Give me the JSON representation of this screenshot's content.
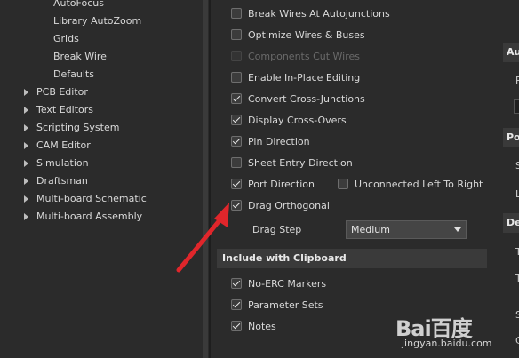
{
  "tree": {
    "subitems": [
      "AutoFocus",
      "Library AutoZoom",
      "Grids",
      "Break Wire",
      "Defaults"
    ],
    "categories": [
      "PCB Editor",
      "Text Editors",
      "Scripting System",
      "CAM Editor",
      "Simulation",
      "Draftsman",
      "Multi-board Schematic",
      "Multi-board Assembly"
    ]
  },
  "options": [
    {
      "label": "Break Wires At Autojunctions",
      "checked": false,
      "enabled": true
    },
    {
      "label": "Optimize Wires & Buses",
      "checked": false,
      "enabled": true
    },
    {
      "label": "Components Cut Wires",
      "checked": false,
      "enabled": false
    },
    {
      "label": "Enable In-Place Editing",
      "checked": false,
      "enabled": true
    },
    {
      "label": "Convert Cross-Junctions",
      "checked": true,
      "enabled": true
    },
    {
      "label": "Display Cross-Overs",
      "checked": true,
      "enabled": true
    },
    {
      "label": "Pin Direction",
      "checked": true,
      "enabled": true
    },
    {
      "label": "Sheet Entry Direction",
      "checked": false,
      "enabled": true
    },
    {
      "label": "Port Direction",
      "checked": true,
      "enabled": true
    },
    {
      "label": "Drag Orthogonal",
      "checked": true,
      "enabled": true
    }
  ],
  "unconnected": {
    "label": "Unconnected Left To Right",
    "checked": false
  },
  "drag_step": {
    "label": "Drag Step",
    "value": "Medium"
  },
  "clipboard": {
    "header": "Include with Clipboard",
    "items": [
      {
        "label": "No-ERC Markers",
        "checked": true
      },
      {
        "label": "Parameter Sets",
        "checked": true
      },
      {
        "label": "Notes",
        "checked": true
      }
    ]
  },
  "right": {
    "headers": [
      "Au",
      "Po",
      "De"
    ],
    "texts": [
      "P",
      "S",
      "L",
      "T",
      "T",
      "S",
      "C"
    ]
  },
  "watermark": {
    "logo": "Bai百度",
    "url": "jingyan.baidu.com"
  },
  "colors": {
    "background": "#2b2b2b",
    "header": "#3a3a3a",
    "arrow": "#e0262b"
  }
}
